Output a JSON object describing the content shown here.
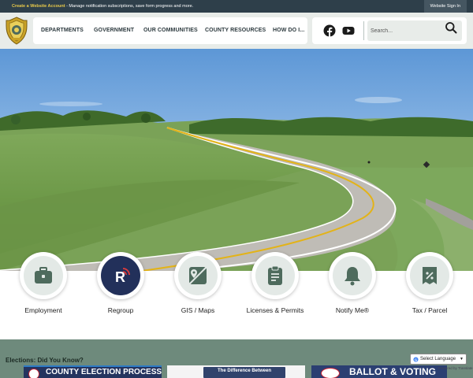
{
  "topbar": {
    "create_account_link": "Create a Website Account",
    "notice_text": " - Manage notification subscriptions, save form progress and more.",
    "sign_in": "Website Sign In"
  },
  "nav": {
    "items": [
      "DEPARTMENTS",
      "GOVERNMENT",
      "OUR COMMUNITIES",
      "COUNTY RESOURCES",
      "HOW DO I..."
    ]
  },
  "social": {
    "icons": [
      "facebook-icon",
      "youtube-icon"
    ]
  },
  "search": {
    "placeholder": "Search..."
  },
  "quick_links": [
    {
      "label": "Employment",
      "icon": "briefcase-icon"
    },
    {
      "label": "Regroup",
      "icon": "regroup-logo-icon"
    },
    {
      "label": "GIS / Maps",
      "icon": "map-icon"
    },
    {
      "label": "Licenses & Permits",
      "icon": "clipboard-icon"
    },
    {
      "label": "Notify Me®",
      "icon": "bell-icon"
    },
    {
      "label": "Tax / Parcel",
      "icon": "tax-tag-icon"
    }
  ],
  "elections": {
    "heading": "Elections: Did You Know?",
    "banners": [
      "COUNTY ELECTION PROCESS",
      "The Difference Between",
      "BALLOT & VOTING"
    ]
  },
  "translate": {
    "label": "Select Language",
    "powered": "Powered by Translate"
  },
  "colors": {
    "topbar_bg": "#2e3f4a",
    "header_bg": "#e8ece9",
    "accent_green": "#4e6b5d",
    "elections_bg": "#6e8a7c",
    "link_yellow": "#e8c94a"
  }
}
